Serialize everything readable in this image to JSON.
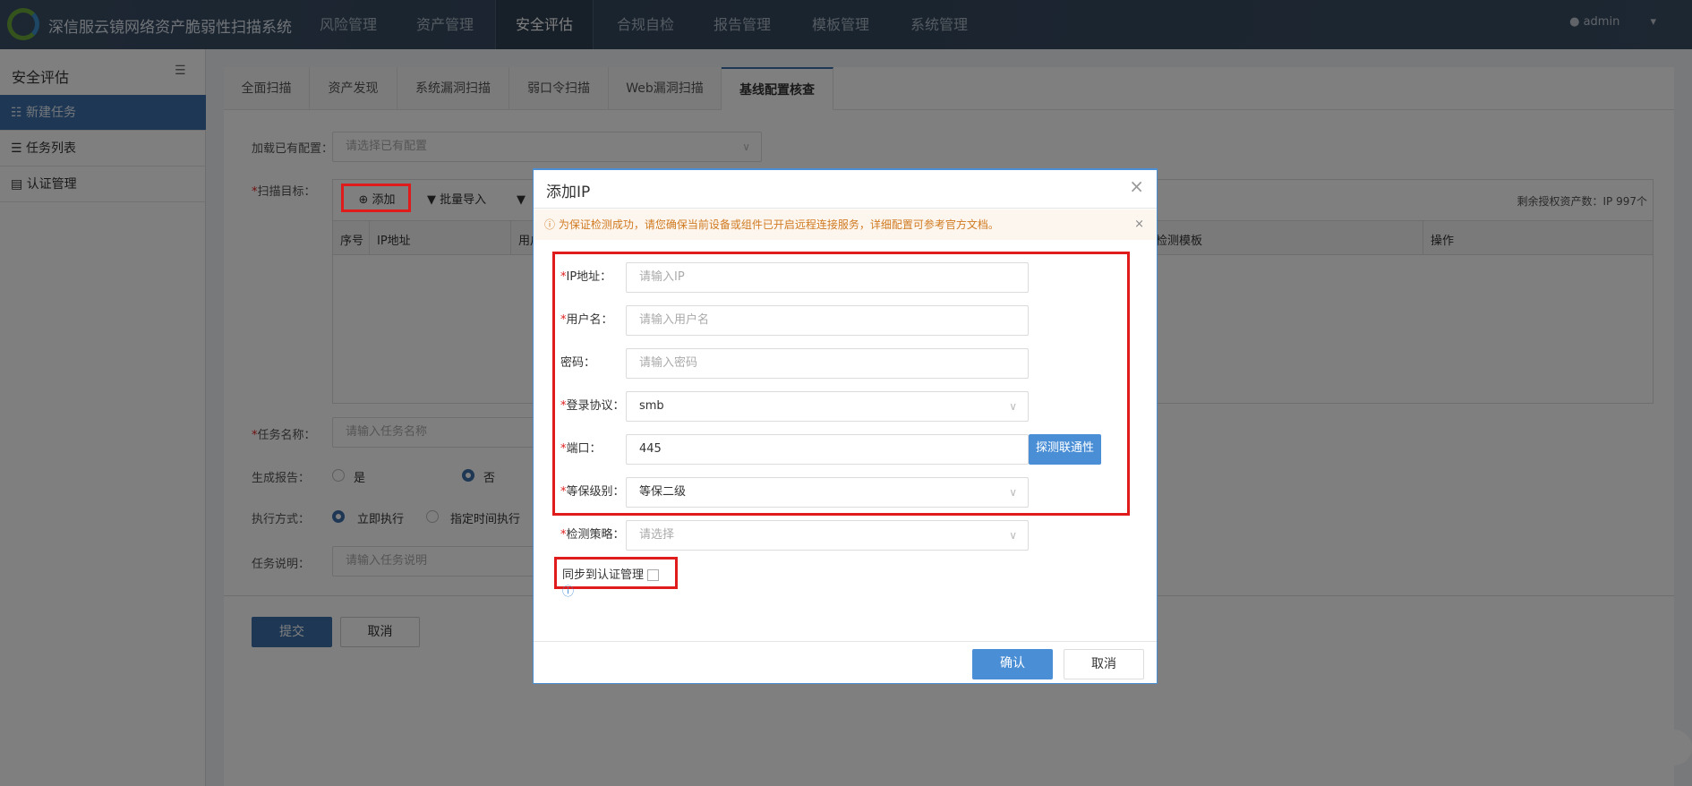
{
  "header": {
    "brand": "深信服云镜网络资产脆弱性扫描系统",
    "nav": [
      "风险管理",
      "资产管理",
      "安全评估",
      "合规自检",
      "报告管理",
      "模板管理",
      "系统管理"
    ],
    "active_nav": "安全评估",
    "user": "admin"
  },
  "sidebar": {
    "title": "安全评估",
    "items": [
      {
        "label": "新建任务",
        "active": true
      },
      {
        "label": "任务列表"
      },
      {
        "label": "认证管理"
      }
    ]
  },
  "tabs": [
    "全面扫描",
    "资产发现",
    "系统漏洞扫描",
    "弱口令扫描",
    "Web漏洞扫描",
    "基线配置核查"
  ],
  "active_tab": "基线配置核查",
  "form": {
    "load_label": "加载已有配置：",
    "load_placeholder": "请选择已有配置",
    "target_label": "扫描目标：",
    "add": "添加",
    "batch_import": "批量导入",
    "remaining": "剩余授权资产数：IP 997个",
    "columns": [
      "序号",
      "IP地址",
      "用户",
      "检测模板",
      "操作"
    ],
    "task_name_label": "任务名称：",
    "task_name_placeholder": "请输入任务名称",
    "report_label": "生成报告：",
    "report_options": [
      "是",
      "否"
    ],
    "report_selected": "否",
    "exec_label": "执行方式：",
    "exec_options": [
      "立即执行",
      "指定时间执行"
    ],
    "exec_selected": "立即执行",
    "desc_label": "任务说明：",
    "desc_placeholder": "请输入任务说明",
    "submit": "提交",
    "cancel": "取消"
  },
  "dialog": {
    "title": "添加IP",
    "alert": "为保证检测成功，请您确保当前设备或组件已开启远程连接服务，详细配置可参考官方文档。",
    "fields": [
      {
        "label": "IP地址：",
        "required": true,
        "placeholder": "请输入IP",
        "value": ""
      },
      {
        "label": "用户名：",
        "required": true,
        "placeholder": "请输入用户名",
        "value": ""
      },
      {
        "label": "密码：",
        "required": false,
        "placeholder": "请输入密码",
        "value": ""
      },
      {
        "label": "登录协议：",
        "required": true,
        "value": "smb",
        "type": "select"
      },
      {
        "label": "端口：",
        "required": true,
        "value": "445"
      },
      {
        "label": "等保级别：",
        "required": true,
        "value": "等保二级",
        "type": "select"
      },
      {
        "label": "检测策略：",
        "required": true,
        "placeholder": "请选择",
        "type": "select"
      }
    ],
    "probe_button": "探测联通性",
    "sync_label": "同步到认证管理",
    "sync_checked": false,
    "confirm": "确认",
    "cancel": "取消"
  },
  "colors": {
    "accent": "#3d6fa8",
    "dialog_button": "#4a8fd6",
    "highlight": "#e01b1b",
    "alert_text": "#d07a20"
  }
}
